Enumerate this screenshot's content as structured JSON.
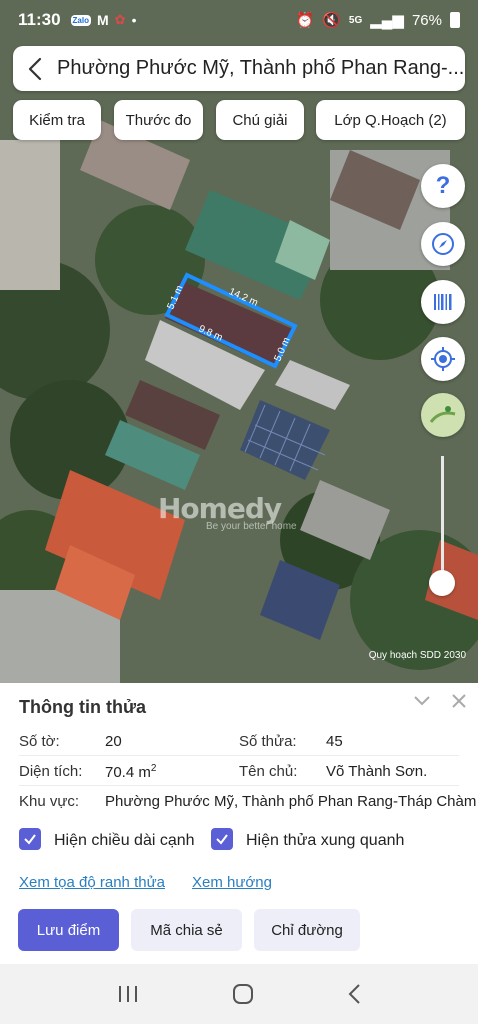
{
  "status_bar": {
    "time": "11:30",
    "battery": "76%",
    "network": "5G"
  },
  "search": {
    "title": "Phường Phước Mỹ, Thành phố Phan Rang-..."
  },
  "chips": {
    "check": "Kiểm tra",
    "ruler": "Thước đo",
    "legend": "Chú giải",
    "layers": "Lớp Q.Hoạch (2)"
  },
  "map": {
    "measurements": {
      "top": "14.2 m",
      "left": "5.1 m",
      "bottom": "9.8 m",
      "right": "5.0 m"
    },
    "watermark_name": "Homedy",
    "watermark_tag": "Be your better home",
    "planning_label": "Quy hoạch SDD 2030"
  },
  "panel": {
    "title": "Thông tin thửa",
    "sheet_label": "Số tờ:",
    "sheet_value": "20",
    "parcel_label": "Số thửa:",
    "parcel_value": "45",
    "area_label": "Diện tích:",
    "area_value": "70.4 m",
    "area_unit_sup": "2",
    "owner_label": "Tên chủ:",
    "owner_value": "Võ Thành Sơn.",
    "region_label": "Khu vực:",
    "region_value": "Phường Phước Mỹ, Thành phố Phan Rang-Tháp Chàm",
    "show_edge_length": "Hiện chiều dài cạnh",
    "show_neighbors": "Hiện thửa xung quanh",
    "link_coords": "Xem tọa độ ranh thửa",
    "link_direction": "Xem hướng",
    "btn_save": "Lưu điểm",
    "btn_share": "Mã chia sẻ",
    "btn_route": "Chỉ đường"
  },
  "colors": {
    "accent": "#5b5fd6",
    "link": "#2a7fc1",
    "parcel_outline": "#1e8fff"
  }
}
